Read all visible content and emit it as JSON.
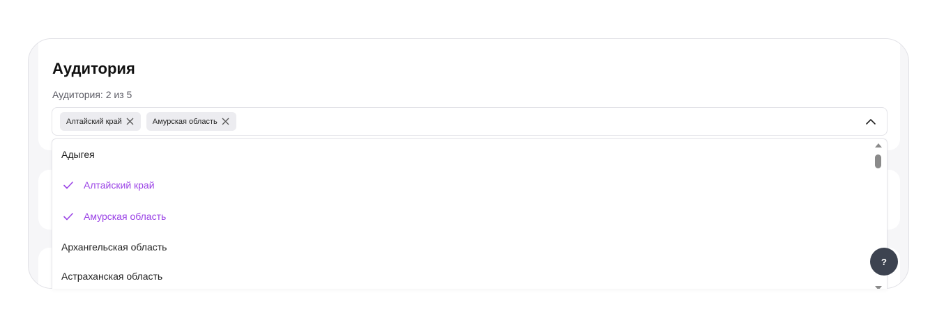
{
  "section": {
    "title": "Аудитория",
    "counter": "Аудитория: 2 из 5"
  },
  "selected_chips": [
    {
      "label": "Алтайский край"
    },
    {
      "label": "Амурская область"
    }
  ],
  "options": [
    {
      "label": "Адыгея",
      "selected": false
    },
    {
      "label": "Алтайский край",
      "selected": true
    },
    {
      "label": "Амурская область",
      "selected": true
    },
    {
      "label": "Архангельская область",
      "selected": false
    },
    {
      "label": "Астраханская область",
      "selected": false
    }
  ],
  "help_button": {
    "label": "?"
  },
  "colors": {
    "accent": "#9b43e6",
    "help_bg": "#3d4350"
  },
  "icons": {
    "chip_remove": "close-icon",
    "select_toggle": "chevron-up-icon",
    "option_selected": "check-icon"
  }
}
